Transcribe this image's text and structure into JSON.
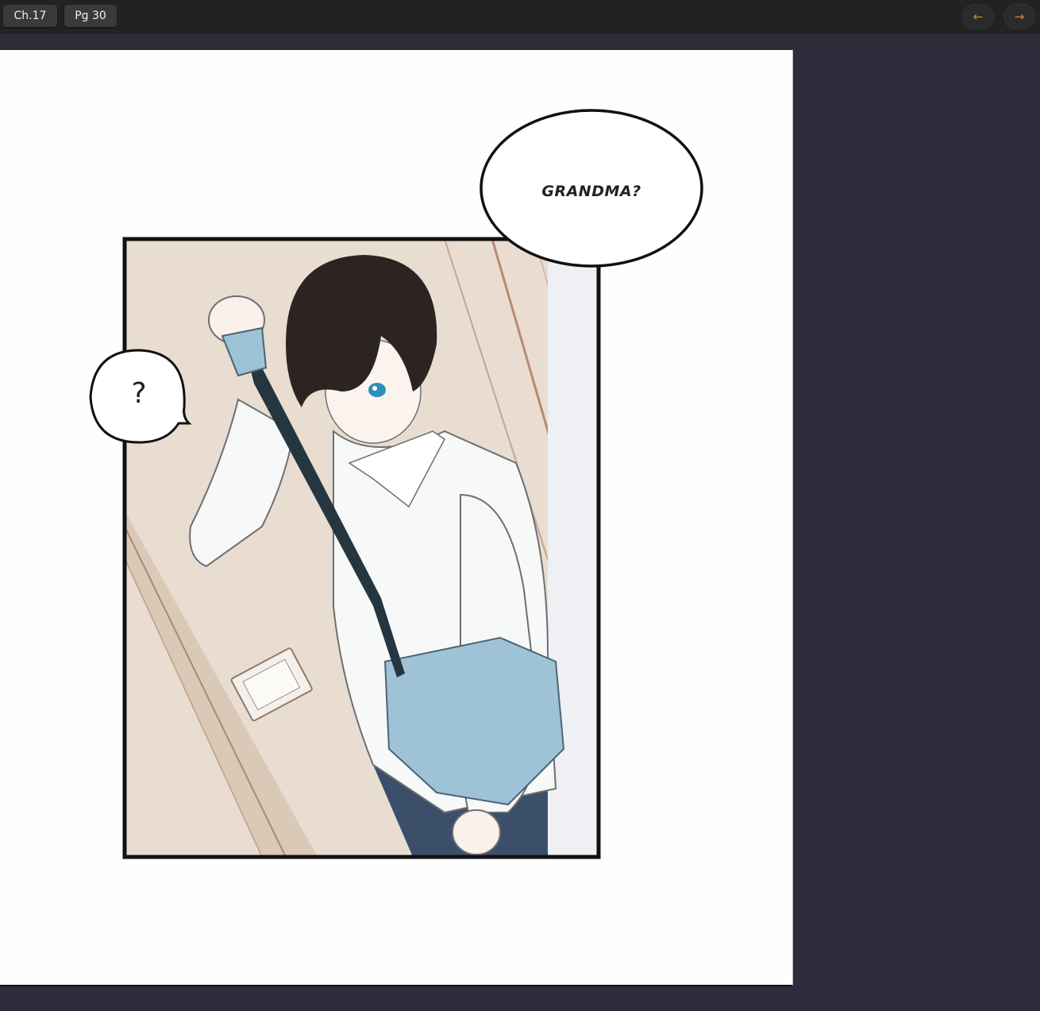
{
  "toolbar": {
    "chapter_label": "Ch.17",
    "page_label": "Pg 30",
    "prev_label": "←",
    "next_label": "→"
  },
  "comic": {
    "bubbles": [
      {
        "text": "GRANDMA?"
      },
      {
        "text": "?"
      }
    ]
  },
  "colors": {
    "toolbar_bg": "#222222",
    "viewer_bg": "#2d2c3a",
    "accent": "#d2883a"
  }
}
